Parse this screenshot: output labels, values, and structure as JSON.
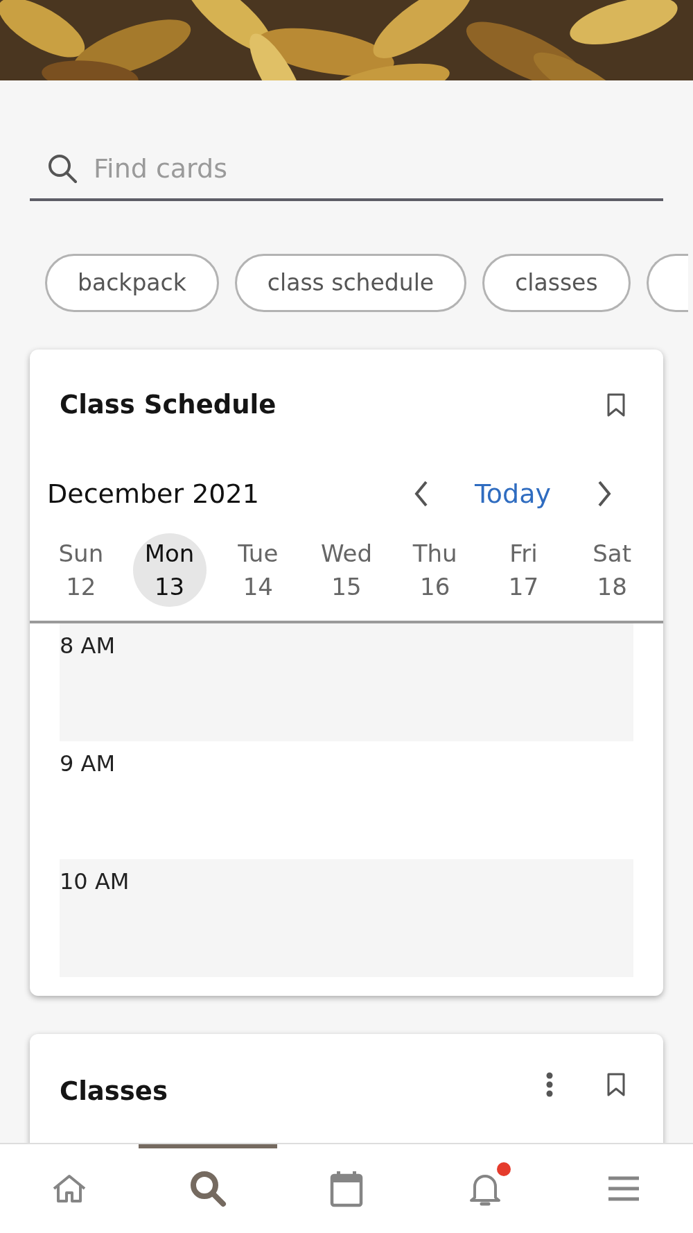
{
  "search": {
    "placeholder": "Find cards"
  },
  "chips": [
    {
      "label": "backpack"
    },
    {
      "label": "class schedule"
    },
    {
      "label": "classes"
    }
  ],
  "schedule_card": {
    "title": "Class Schedule",
    "bookmarked": false,
    "month": "December 2021",
    "today_button": "Today",
    "days": [
      {
        "name": "Sun",
        "date": "12",
        "selected": false
      },
      {
        "name": "Mon",
        "date": "13",
        "selected": true
      },
      {
        "name": "Tue",
        "date": "14",
        "selected": false
      },
      {
        "name": "Wed",
        "date": "15",
        "selected": false
      },
      {
        "name": "Thu",
        "date": "16",
        "selected": false
      },
      {
        "name": "Fri",
        "date": "17",
        "selected": false
      },
      {
        "name": "Sat",
        "date": "18",
        "selected": false
      }
    ],
    "time_slots": [
      {
        "label": "8 AM"
      },
      {
        "label": "9 AM"
      },
      {
        "label": "10 AM"
      }
    ]
  },
  "classes_card": {
    "title": "Classes",
    "bookmarked": false
  },
  "nav": [
    {
      "selected": false,
      "badge": false
    },
    {
      "selected": true,
      "badge": false
    },
    {
      "selected": false,
      "badge": false
    },
    {
      "selected": false,
      "badge": true
    },
    {
      "selected": false,
      "badge": false
    }
  ]
}
